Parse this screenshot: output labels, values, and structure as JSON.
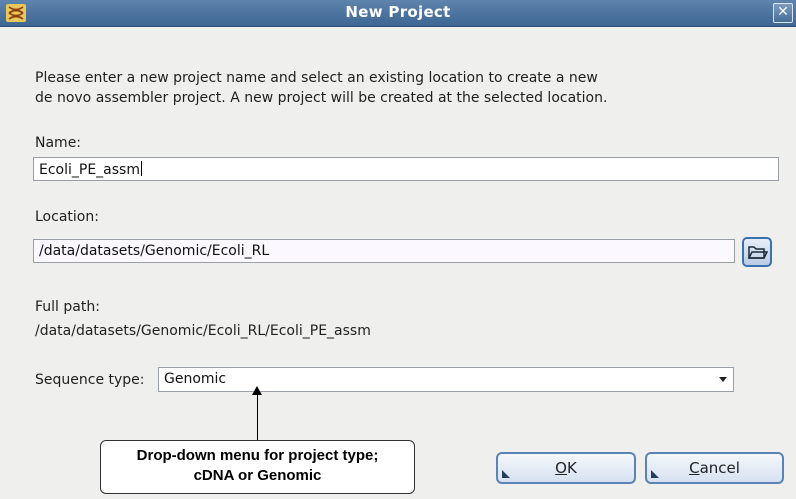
{
  "window": {
    "title": "New Project",
    "close_glyph": "✕",
    "icon": "dna-helix-icon"
  },
  "description_line1": "Please enter a new project name and select an existing location to create a new",
  "description_line2": "de novo assembler project. A new project will be created at the selected location.",
  "name": {
    "label": "Name:",
    "value": "Ecoli_PE_assm"
  },
  "location": {
    "label": "Location:",
    "value": "/data/datasets/Genomic/Ecoli_RL",
    "browse_icon": "folder-open-icon"
  },
  "full_path": {
    "label": "Full path:",
    "value": "/data/datasets/Genomic/Ecoli_RL/Ecoli_PE_assm"
  },
  "sequence_type": {
    "label": "Sequence type:",
    "value": "Genomic"
  },
  "callout": {
    "line1": "Drop-down menu for project type;",
    "line2": "cDNA or Genomic"
  },
  "buttons": {
    "ok": {
      "mnemonic": "O",
      "rest": "K"
    },
    "cancel": {
      "mnemonic": "C",
      "rest": "ancel"
    }
  }
}
